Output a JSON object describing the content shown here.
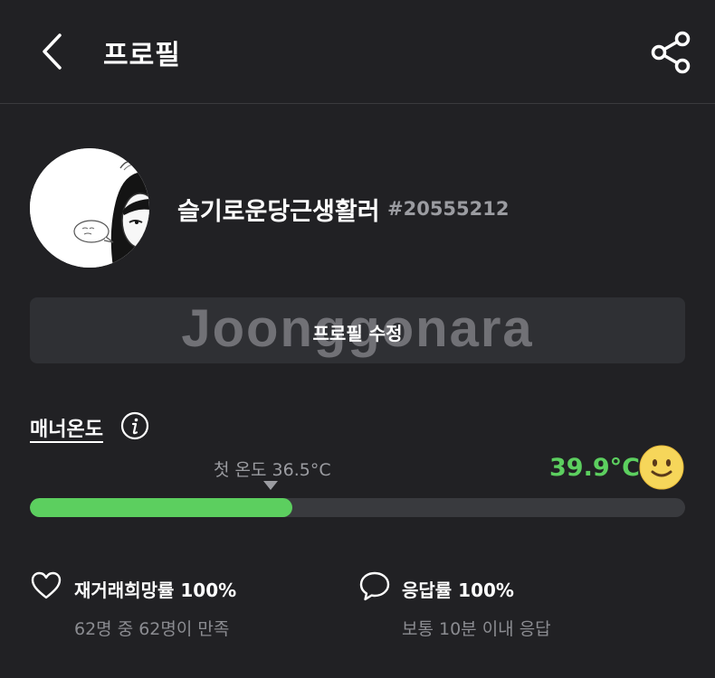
{
  "header": {
    "title": "프로필",
    "back_icon": "chevron-left-icon",
    "share_icon": "share-icon"
  },
  "profile": {
    "nickname": "슬기로운당근생활러",
    "user_id": "#20555212",
    "edit_label": "프로필 수정"
  },
  "watermark": "Joonggonara",
  "manner": {
    "label": "매너온도",
    "first_temp_label": "첫 온도 36.5°C",
    "temperature": "39.9°C",
    "progress_fraction": 0.4,
    "color": "#5ccf5f",
    "emoji": "smiley-face-icon"
  },
  "stats": [
    {
      "icon": "heart-icon",
      "title": "재거래희망률 100%",
      "subtitle": "62명 중 62명이 만족"
    },
    {
      "icon": "chat-bubble-icon",
      "title": "응답률 100%",
      "subtitle": "보통 10분 이내 응답"
    }
  ]
}
